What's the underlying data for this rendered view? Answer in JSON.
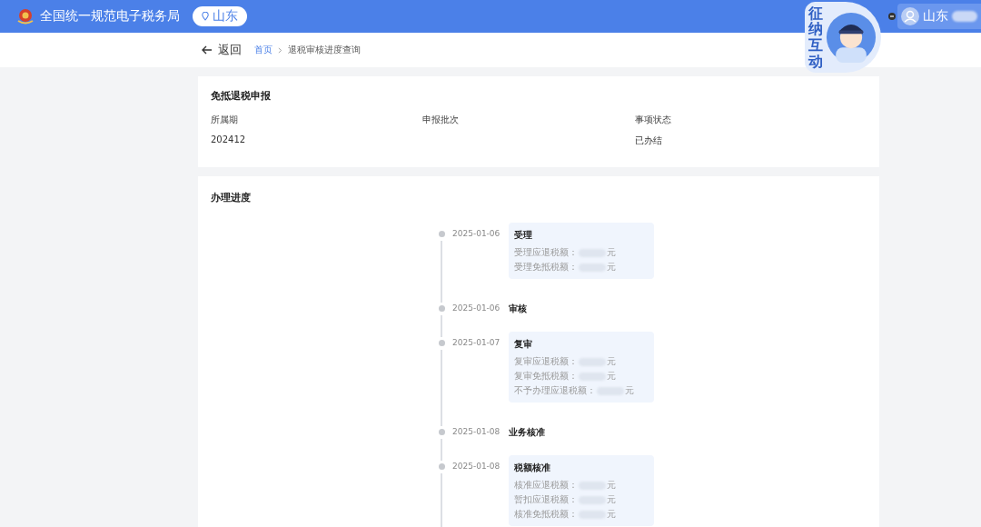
{
  "header": {
    "site_title": "全国统一规范电子税务局",
    "region": "山东",
    "user": "山东"
  },
  "mascot": {
    "caption": "征纳互动"
  },
  "nav": {
    "back": "返回",
    "breadcrumb": [
      {
        "label": "首页",
        "kind": "link"
      },
      {
        "label": "退税审核进度查询",
        "kind": "current"
      }
    ]
  },
  "summary": {
    "title": "免抵退税申报",
    "fields": [
      {
        "label": "所属期",
        "value": "202412"
      },
      {
        "label": "申报批次"
      },
      {
        "label": "事项状态",
        "value": "已办结"
      }
    ]
  },
  "progress": {
    "title": "办理进度",
    "steps": [
      {
        "date": "2025-01-06",
        "title": "受理",
        "kind": "card",
        "lines": [
          {
            "label": "受理应退税额：",
            "unit": "元"
          },
          {
            "label": "受理免抵税额：",
            "unit": "元"
          }
        ]
      },
      {
        "date": "2025-01-06",
        "title": "审核",
        "kind": "plain"
      },
      {
        "date": "2025-01-07",
        "title": "复审",
        "kind": "card",
        "lines": [
          {
            "label": "复审应退税额：",
            "unit": "元"
          },
          {
            "label": "复审免抵税额：",
            "unit": "元"
          },
          {
            "label": "不予办理应退税额：",
            "unit": "元"
          }
        ]
      },
      {
        "date": "2025-01-08",
        "title": "业务核准",
        "kind": "plain"
      },
      {
        "date": "2025-01-08",
        "title": "税额核准",
        "kind": "card",
        "lines": [
          {
            "label": "核准应退税额：",
            "unit": "元"
          },
          {
            "label": "暂扣应退税额：",
            "unit": "元"
          },
          {
            "label": "核准免抵税额：",
            "unit": "元"
          }
        ]
      }
    ]
  }
}
